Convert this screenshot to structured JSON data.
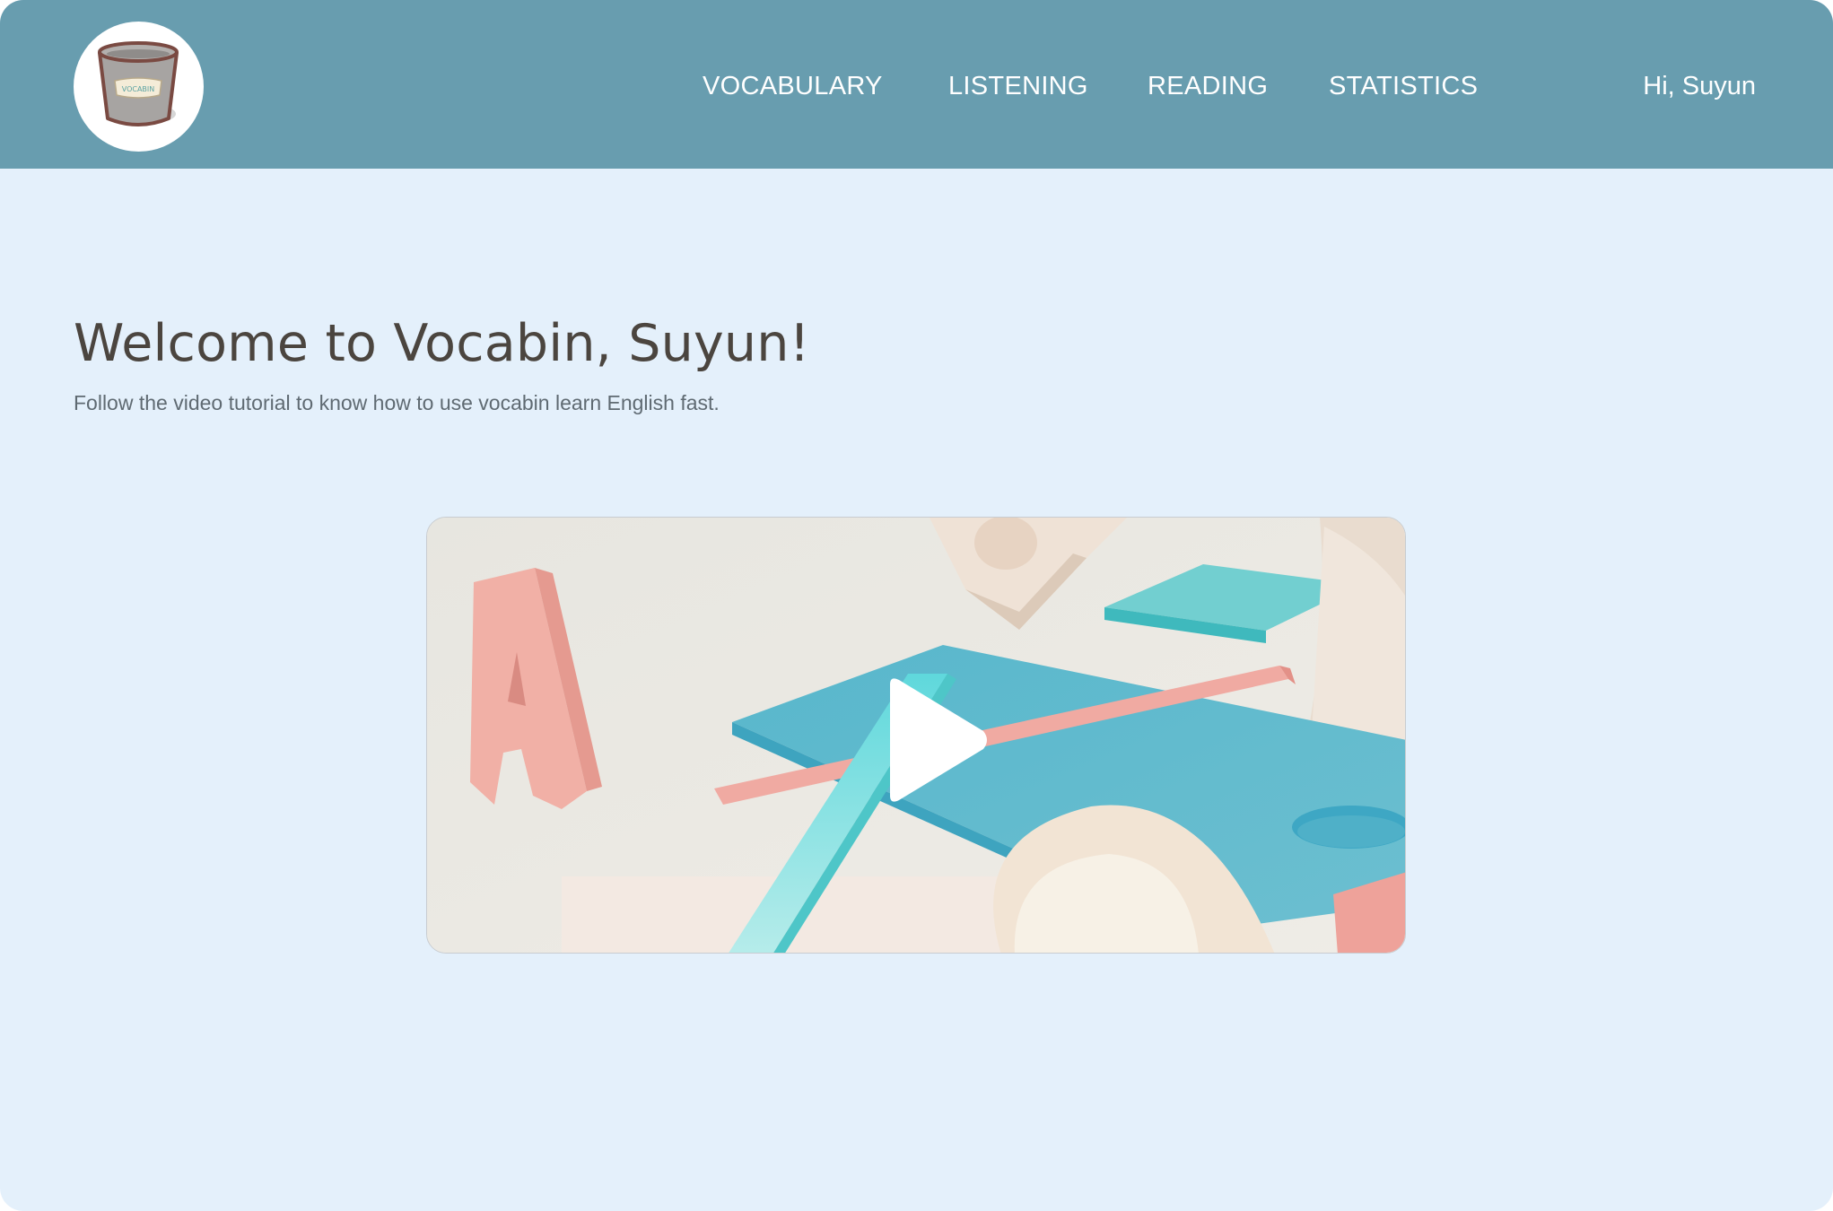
{
  "logo": {
    "label": "VOCABIN"
  },
  "nav": {
    "items": [
      {
        "label": "VOCABULARY"
      },
      {
        "label": "LISTENING"
      },
      {
        "label": "READING"
      },
      {
        "label": "STATISTICS"
      }
    ]
  },
  "user": {
    "greeting": "Hi, Suyun"
  },
  "main": {
    "title": "Welcome to Vocabin, Suyun!",
    "subtitle": "Follow the video tutorial to know how to use vocabin learn English fast."
  },
  "video": {
    "thumbnail_letter": "A",
    "play_icon": "play-icon"
  },
  "colors": {
    "header": "#689daf",
    "background": "#e4f0fb",
    "title": "#4b453f",
    "subtitle": "#5f6a72",
    "accent_pink": "#eea89f",
    "accent_teal": "#5fc8cc",
    "accent_blue": "#5bb4cb"
  }
}
